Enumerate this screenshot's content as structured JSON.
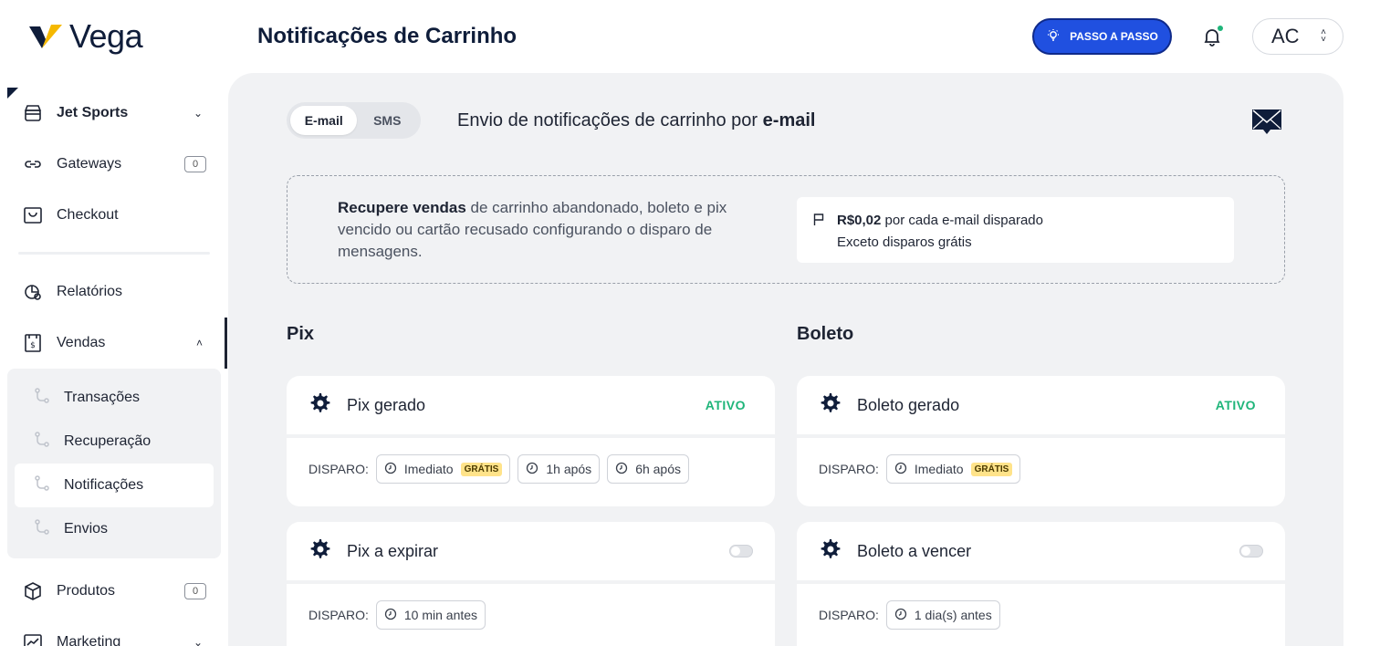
{
  "brand": {
    "name": "Vega",
    "accent": "#f5b800"
  },
  "header": {
    "title": "Notificações de Carrinho",
    "guide_button": "PASSO A PASSO",
    "account_initials": "AC"
  },
  "sidebar": {
    "items": [
      {
        "label": "Jet Sports",
        "icon": "store-icon"
      },
      {
        "label": "Gateways",
        "icon": "link-icon",
        "badge": "0"
      },
      {
        "label": "Checkout",
        "icon": "cart-icon"
      },
      {
        "label": "Relatórios",
        "icon": "report-icon"
      },
      {
        "label": "Vendas",
        "icon": "sales-icon"
      },
      {
        "label": "Produtos",
        "icon": "box-icon",
        "badge": "0"
      },
      {
        "label": "Marketing",
        "icon": "chart-icon"
      }
    ],
    "sub_items": [
      {
        "label": "Transações"
      },
      {
        "label": "Recuperação"
      },
      {
        "label": "Notificações"
      },
      {
        "label": "Envios"
      }
    ]
  },
  "main": {
    "tabs": [
      {
        "label": "E-mail"
      },
      {
        "label": "SMS"
      }
    ],
    "subtitle_prefix": "Envio de notificações de carrinho por",
    "subtitle_bold": "e-mail",
    "info": {
      "bold": "Recupere vendas",
      "rest": "de carrinho abandonado, boleto e pix vencido ou cartão recusado configurando o disparo de mensagens."
    },
    "price": {
      "value": "R$0,02",
      "suffix": "por cada e-mail disparado",
      "note": "Exceto disparos grátis"
    },
    "disparo_label": "DISPARO:",
    "gratis_label": "GRÁTIS",
    "sections": [
      {
        "title": "Pix",
        "cards": [
          {
            "name": "Pix gerado",
            "status": "ATIVO",
            "triggers": [
              "Imediato",
              "1h após",
              "6h após"
            ]
          },
          {
            "name": "Pix a expirar",
            "status": "",
            "triggers": [
              "10 min antes"
            ]
          }
        ]
      },
      {
        "title": "Boleto",
        "cards": [
          {
            "name": "Boleto gerado",
            "status": "ATIVO",
            "triggers": [
              "Imediato"
            ]
          },
          {
            "name": "Boleto a vencer",
            "status": "",
            "triggers": [
              "1 dia(s) antes"
            ]
          }
        ]
      }
    ]
  }
}
